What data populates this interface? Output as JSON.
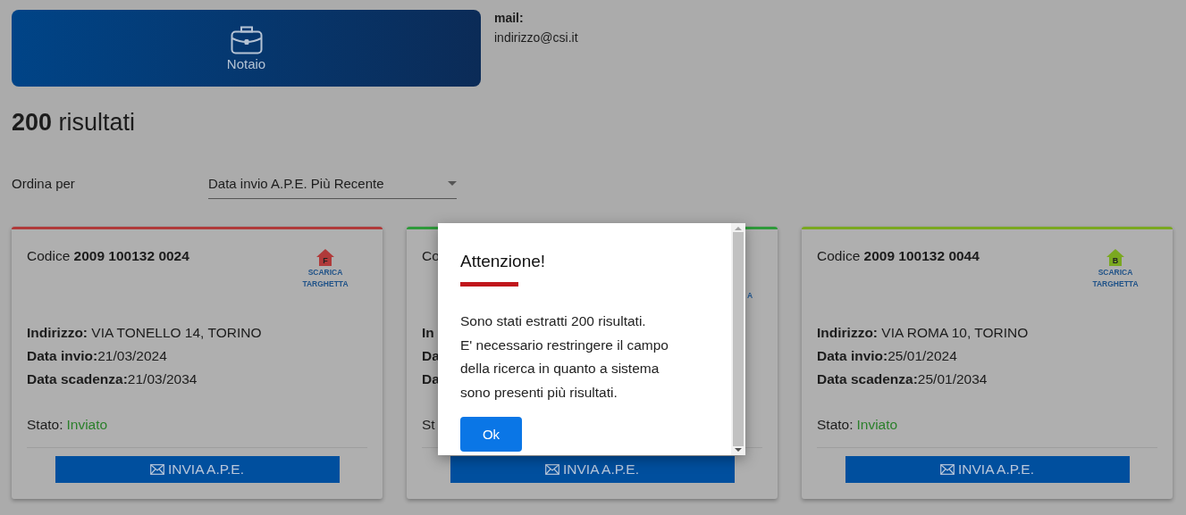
{
  "header": {
    "role": "Notaio",
    "mail_label": "mail:",
    "mail": "indirizzo@csi.it"
  },
  "results": {
    "count": "200",
    "label": "risultati"
  },
  "sort": {
    "label": "Ordina per",
    "value": "Data invio A.P.E. Più Recente"
  },
  "cards": [
    {
      "kind": "full",
      "color": "#b03a3a",
      "codice": "Codice **2009 100132 0024**",
      "energy_class": "F",
      "targhetta": "SCARICA TARGHETTA",
      "fields": [
        "**Indirizzo:** VIA TONELLO 14, TORINO",
        "**Data invio:**21/03/2024",
        "**Data scadenza:**21/03/2034"
      ],
      "stato_label": "Stato:",
      "stato": "Inviato",
      "button": "INVIA A.P.E."
    },
    {
      "kind": "covered",
      "color": "#2e9a3a",
      "fragments": [
        {
          "text": "Co",
          "bold": false
        },
        {
          "text": "In",
          "bold": true
        },
        {
          "text": "Da",
          "bold": true
        },
        {
          "text": "Da",
          "bold": true
        },
        {
          "text": "St",
          "bold": false
        }
      ],
      "targhetta_fragment": "A",
      "button": "INVIA A.P.E."
    },
    {
      "kind": "full",
      "color": "#7aa820",
      "codice": "Codice **2009 100132 0044**",
      "energy_class": "B",
      "targhetta": "SCARICA TARGHETTA",
      "fields": [
        "**Indirizzo:** VIA ROMA 10, TORINO",
        "**Data invio:**25/01/2024",
        "**Data scadenza:**25/01/2034"
      ],
      "stato_label": "Stato:",
      "stato": "Inviato",
      "button": "INVIA A.P.E."
    }
  ],
  "dialog": {
    "title": "Attenzione!",
    "lines": [
      "Sono stati estratti 200 risultati.",
      "E' necessario restringere il campo",
      "della ricerca in quanto a sistema",
      "sono presenti più risultati."
    ],
    "button": "Ok"
  }
}
